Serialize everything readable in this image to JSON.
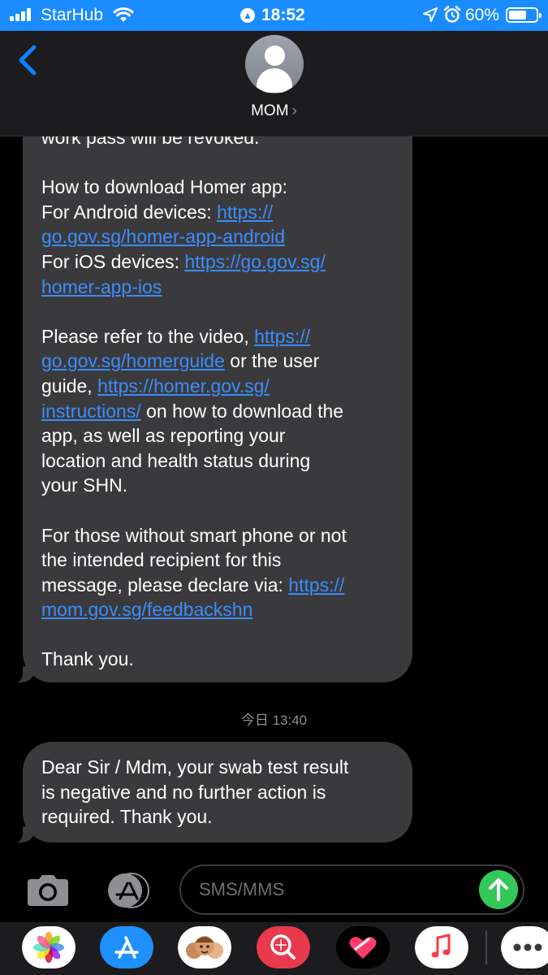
{
  "status_bar": {
    "carrier": "StarHub",
    "time": "18:52",
    "battery": "60%",
    "battery_level": 0.6,
    "icons": [
      "signal-icon",
      "wifi-icon",
      "location-icon",
      "navigation-arrow-icon",
      "alarm-icon",
      "battery-icon"
    ]
  },
  "header": {
    "contact_name": "MOM",
    "chevron": "›"
  },
  "messages": {
    "bubble1": {
      "lines": [
        [
          {
            "t": "work pass will be revoked."
          }
        ],
        [],
        [
          {
            "t": "How to download Homer app:"
          }
        ],
        [
          {
            "t": "For Android devices: "
          },
          {
            "t": "https://",
            "link": true
          }
        ],
        [
          {
            "t": "go.gov.sg/homer-app-android",
            "link": true
          }
        ],
        [
          {
            "t": "For iOS devices: "
          },
          {
            "t": "https://go.gov.sg/",
            "link": true
          }
        ],
        [
          {
            "t": "homer-app-ios",
            "link": true
          }
        ],
        [],
        [
          {
            "t": "Please refer to the video, "
          },
          {
            "t": "https://",
            "link": true
          }
        ],
        [
          {
            "t": "go.gov.sg/homerguide",
            "link": true
          },
          {
            "t": " or the user"
          }
        ],
        [
          {
            "t": "guide, "
          },
          {
            "t": "https://homer.gov.sg/",
            "link": true
          }
        ],
        [
          {
            "t": "instructions/",
            "link": true
          },
          {
            "t": " on how to download the"
          }
        ],
        [
          {
            "t": "app, as well as reporting your"
          }
        ],
        [
          {
            "t": "location and health status during"
          }
        ],
        [
          {
            "t": "your SHN."
          }
        ],
        [],
        [
          {
            "t": "For those without smart phone or not"
          }
        ],
        [
          {
            "t": "the intended recipient for this"
          }
        ],
        [
          {
            "t": "message, please declare via: "
          },
          {
            "t": "https://",
            "link": true
          }
        ],
        [
          {
            "t": "mom.gov.sg/feedbackshn",
            "link": true
          }
        ],
        [],
        [
          {
            "t": "Thank you."
          }
        ]
      ]
    },
    "timestamp": "今日 13:40",
    "bubble2": {
      "lines": [
        [
          {
            "t": "Dear Sir / Mdm, your swab test result"
          }
        ],
        [
          {
            "t": "is negative and no further action is"
          }
        ],
        [
          {
            "t": "required. Thank you."
          }
        ]
      ]
    }
  },
  "composer": {
    "placeholder": "SMS/MMS",
    "icons": [
      "camera-icon",
      "app-store-icon",
      "send-arrow-icon"
    ]
  },
  "app_drawer": {
    "apps": [
      "photos-app-icon",
      "app-store-app-icon",
      "memoji-app-icon",
      "image-search-app-icon",
      "digital-touch-app-icon",
      "music-app-icon",
      "more-apps-icon"
    ]
  },
  "colors": {
    "status_bar_bg": "#1a8cff",
    "bubble_bg": "#3a3a3c",
    "link": "#3c8cff",
    "send": "#34c759"
  }
}
